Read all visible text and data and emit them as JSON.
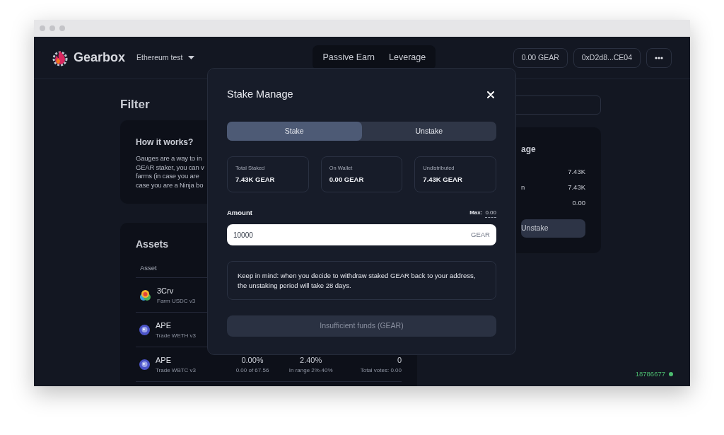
{
  "header": {
    "brand": "Gearbox",
    "network": "Ethereum test",
    "nav": [
      {
        "label": "Passive Earn",
        "selected": false
      },
      {
        "label": "Leverage",
        "selected": false
      }
    ],
    "balance": "0.00 GEAR",
    "address": "0xD2d8...CE04"
  },
  "page": {
    "title": "Filter",
    "info": {
      "title": "How it works?",
      "lines": [
        "Gauges are a way to in",
        "GEAR staker, you can v",
        "farms (in case you are",
        "case you are a Ninja bo"
      ]
    },
    "assets": {
      "title": "Assets",
      "column_1": "Asset",
      "rows": [
        {
          "kind": "lp",
          "name": "3Crv",
          "sub": "Farm USDC v3"
        },
        {
          "kind": "token",
          "name": "APE",
          "sub": "Trade WETH v3"
        },
        {
          "kind": "token",
          "name": "APE",
          "sub": "Trade WBTC v3",
          "share": "0.00%",
          "share_sub": "0.00 of 67.56",
          "apy": "2.40%",
          "apy_sub": "In range 2%-40%",
          "votes": "0",
          "votes_sub": "Total votes: 0.00"
        }
      ]
    },
    "summary": {
      "title": "age",
      "rows": [
        {
          "value": "7.43K"
        },
        {
          "label": "n",
          "value": "7.43K"
        },
        {
          "value": "0.00"
        }
      ],
      "button": "Unstake"
    }
  },
  "modal": {
    "title": "Stake Manage",
    "tabs": [
      {
        "label": "Stake",
        "selected": true
      },
      {
        "label": "Unstake",
        "selected": false
      }
    ],
    "stats": [
      {
        "label": "Total Staked",
        "value": "7.43K GEAR"
      },
      {
        "label": "On Wallet",
        "value": "0.00 GEAR"
      },
      {
        "label": "Undistributed",
        "value": "7.43K GEAR"
      }
    ],
    "amount": {
      "label": "Amount",
      "max_label": "Max:",
      "max_value": "0.00",
      "value": "10000",
      "suffix": "GEAR"
    },
    "note": "Keep in mind: when you decide to withdraw staked GEAR back to your address, the unstaking period will take 28 days.",
    "submit": {
      "label": "Insufficient funds (GEAR)",
      "disabled": true
    }
  },
  "footer": {
    "block": "18786677",
    "connected": true
  }
}
